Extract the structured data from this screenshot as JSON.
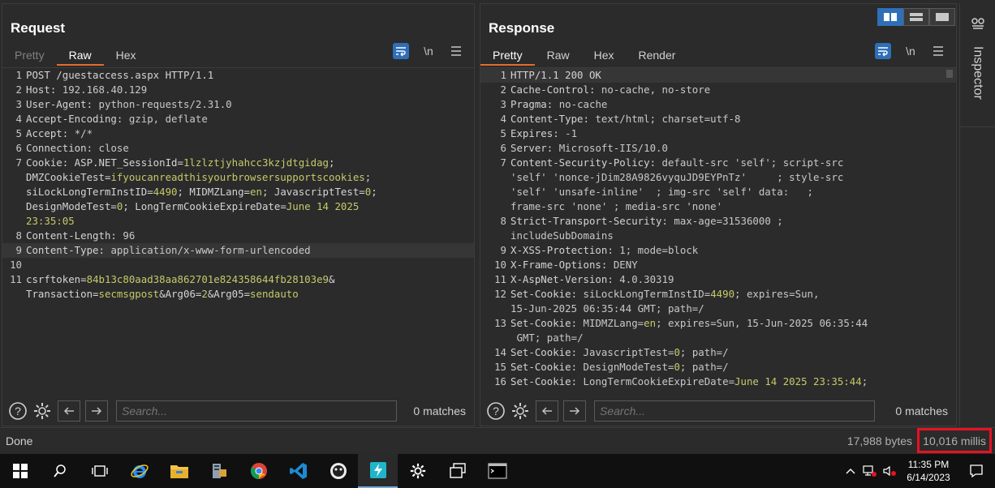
{
  "request": {
    "title": "Request",
    "tabs": [
      {
        "label": "Pretty",
        "state": "dim"
      },
      {
        "label": "Raw",
        "state": "active"
      },
      {
        "label": "Hex",
        "state": ""
      }
    ],
    "newline_toggle": "\\n",
    "search_placeholder": "Search...",
    "matches": "0 matches"
  },
  "response": {
    "title": "Response",
    "tabs": [
      {
        "label": "Pretty",
        "state": "active"
      },
      {
        "label": "Raw",
        "state": ""
      },
      {
        "label": "Hex",
        "state": ""
      },
      {
        "label": "Render",
        "state": ""
      }
    ],
    "newline_toggle": "\\n",
    "search_placeholder": "Search...",
    "matches": "0 matches"
  },
  "request_lines": [
    {
      "n": "1",
      "parts": [
        [
          "k",
          "POST /guestaccess.aspx HTTP/1.1"
        ]
      ]
    },
    {
      "n": "2",
      "parts": [
        [
          "k",
          "Host: "
        ],
        [
          "v",
          "192.168.40.129"
        ]
      ]
    },
    {
      "n": "3",
      "parts": [
        [
          "k",
          "User-Agent: "
        ],
        [
          "v",
          "python-requests/2.31.0"
        ]
      ]
    },
    {
      "n": "4",
      "parts": [
        [
          "k",
          "Accept-Encoding: "
        ],
        [
          "v",
          "gzip, deflate"
        ]
      ]
    },
    {
      "n": "5",
      "parts": [
        [
          "k",
          "Accept: "
        ],
        [
          "v",
          "*/*"
        ]
      ]
    },
    {
      "n": "6",
      "parts": [
        [
          "k",
          "Connection: "
        ],
        [
          "v",
          "close"
        ]
      ]
    },
    {
      "n": "7",
      "parts": [
        [
          "k",
          "Cookie: ASP.NET_SessionId="
        ],
        [
          "c",
          "1lzlztjyhahcc3kzjdtgidag"
        ],
        [
          "k",
          ";\nDMZCookieTest="
        ],
        [
          "c",
          "ifyoucanreadthisyourbrowsersupportscookies"
        ],
        [
          "k",
          ";\nsiLockLongTermInstID="
        ],
        [
          "c",
          "4490"
        ],
        [
          "k",
          "; MIDMZLang="
        ],
        [
          "c",
          "en"
        ],
        [
          "k",
          "; JavascriptTest="
        ],
        [
          "c",
          "0"
        ],
        [
          "k",
          ";\nDesignModeTest="
        ],
        [
          "c",
          "0"
        ],
        [
          "k",
          "; LongTermCookieExpireDate="
        ],
        [
          "c",
          "June 14 2025\n23:35:05"
        ]
      ]
    },
    {
      "n": "8",
      "parts": [
        [
          "k",
          "Content-Length: "
        ],
        [
          "v",
          "96"
        ]
      ]
    },
    {
      "n": "9",
      "parts": [
        [
          "k",
          "Content-Type: "
        ],
        [
          "v",
          "application/x-www-form-urlencoded"
        ]
      ],
      "hl": true
    },
    {
      "n": "10",
      "parts": [
        [
          "k",
          ""
        ]
      ]
    },
    {
      "n": "11",
      "parts": [
        [
          "k",
          "csrftoken="
        ],
        [
          "c",
          "84b13c80aad38aa862701e824358644fb28103e9"
        ],
        [
          "k",
          "&\nTransaction="
        ],
        [
          "c",
          "secmsgpost"
        ],
        [
          "k",
          "&Arg06="
        ],
        [
          "c",
          "2"
        ],
        [
          "k",
          "&Arg05="
        ],
        [
          "c",
          "sendauto"
        ]
      ]
    }
  ],
  "response_lines": [
    {
      "n": "1",
      "parts": [
        [
          "k",
          "HTTP/1.1 200 OK"
        ]
      ],
      "hl": true
    },
    {
      "n": "2",
      "parts": [
        [
          "k",
          "Cache-Control: "
        ],
        [
          "v",
          "no-cache, no-store"
        ]
      ]
    },
    {
      "n": "3",
      "parts": [
        [
          "k",
          "Pragma: "
        ],
        [
          "v",
          "no-cache"
        ]
      ]
    },
    {
      "n": "4",
      "parts": [
        [
          "k",
          "Content-Type: "
        ],
        [
          "v",
          "text/html; charset=utf-8"
        ]
      ]
    },
    {
      "n": "5",
      "parts": [
        [
          "k",
          "Expires: "
        ],
        [
          "v",
          "-1"
        ]
      ]
    },
    {
      "n": "6",
      "parts": [
        [
          "k",
          "Server: "
        ],
        [
          "v",
          "Microsoft-IIS/10.0"
        ]
      ]
    },
    {
      "n": "7",
      "parts": [
        [
          "k",
          "Content-Security-Policy: "
        ],
        [
          "v",
          "default-src 'self'; script-src\n'self' 'nonce-jDim28A9826vyquJD9EYPnTz'     ; style-src\n'self' 'unsafe-inline'  ; img-src 'self' data:   ;\nframe-src 'none' ; media-src 'none'"
        ]
      ]
    },
    {
      "n": "8",
      "parts": [
        [
          "k",
          "Strict-Transport-Security: "
        ],
        [
          "v",
          "max-age=31536000 ;\nincludeSubDomains"
        ]
      ]
    },
    {
      "n": "9",
      "parts": [
        [
          "k",
          "X-XSS-Protection: "
        ],
        [
          "v",
          "1; mode=block"
        ]
      ]
    },
    {
      "n": "10",
      "parts": [
        [
          "k",
          "X-Frame-Options: "
        ],
        [
          "v",
          "DENY"
        ]
      ]
    },
    {
      "n": "11",
      "parts": [
        [
          "k",
          "X-AspNet-Version: "
        ],
        [
          "v",
          "4.0.30319"
        ]
      ]
    },
    {
      "n": "12",
      "parts": [
        [
          "k",
          "Set-Cookie: "
        ],
        [
          "v",
          "siLockLongTermInstID="
        ],
        [
          "c",
          "4490"
        ],
        [
          "v",
          "; expires=Sun,\n15-Jun-2025 06:35:44 GMT; path=/"
        ]
      ]
    },
    {
      "n": "13",
      "parts": [
        [
          "k",
          "Set-Cookie: "
        ],
        [
          "v",
          "MIDMZLang="
        ],
        [
          "c",
          "en"
        ],
        [
          "v",
          "; expires=Sun, 15-Jun-2025 06:35:44\n GMT; path=/"
        ]
      ]
    },
    {
      "n": "14",
      "parts": [
        [
          "k",
          "Set-Cookie: "
        ],
        [
          "v",
          "JavascriptTest="
        ],
        [
          "c",
          "0"
        ],
        [
          "v",
          "; path=/"
        ]
      ]
    },
    {
      "n": "15",
      "parts": [
        [
          "k",
          "Set-Cookie: "
        ],
        [
          "v",
          "DesignModeTest="
        ],
        [
          "c",
          "0"
        ],
        [
          "v",
          "; path=/"
        ]
      ]
    },
    {
      "n": "16",
      "parts": [
        [
          "k",
          "Set-Cookie: "
        ],
        [
          "v",
          "LongTermCookieExpireDate="
        ],
        [
          "c",
          "June 14 2025 23:35:44"
        ],
        [
          "v",
          ";"
        ]
      ]
    }
  ],
  "inspector": {
    "label": "Inspector"
  },
  "status": {
    "left": "Done",
    "bytes": "17,988 bytes",
    "millis": "10,016 millis"
  },
  "taskbar": {
    "time": "11:35 PM",
    "date": "6/14/2023"
  },
  "colors": {
    "accent_tab": "#e36b2d",
    "toggle_blue": "#2f6fb8",
    "highlight_box": "#e81123",
    "cookie_value": "#c6c96a"
  }
}
